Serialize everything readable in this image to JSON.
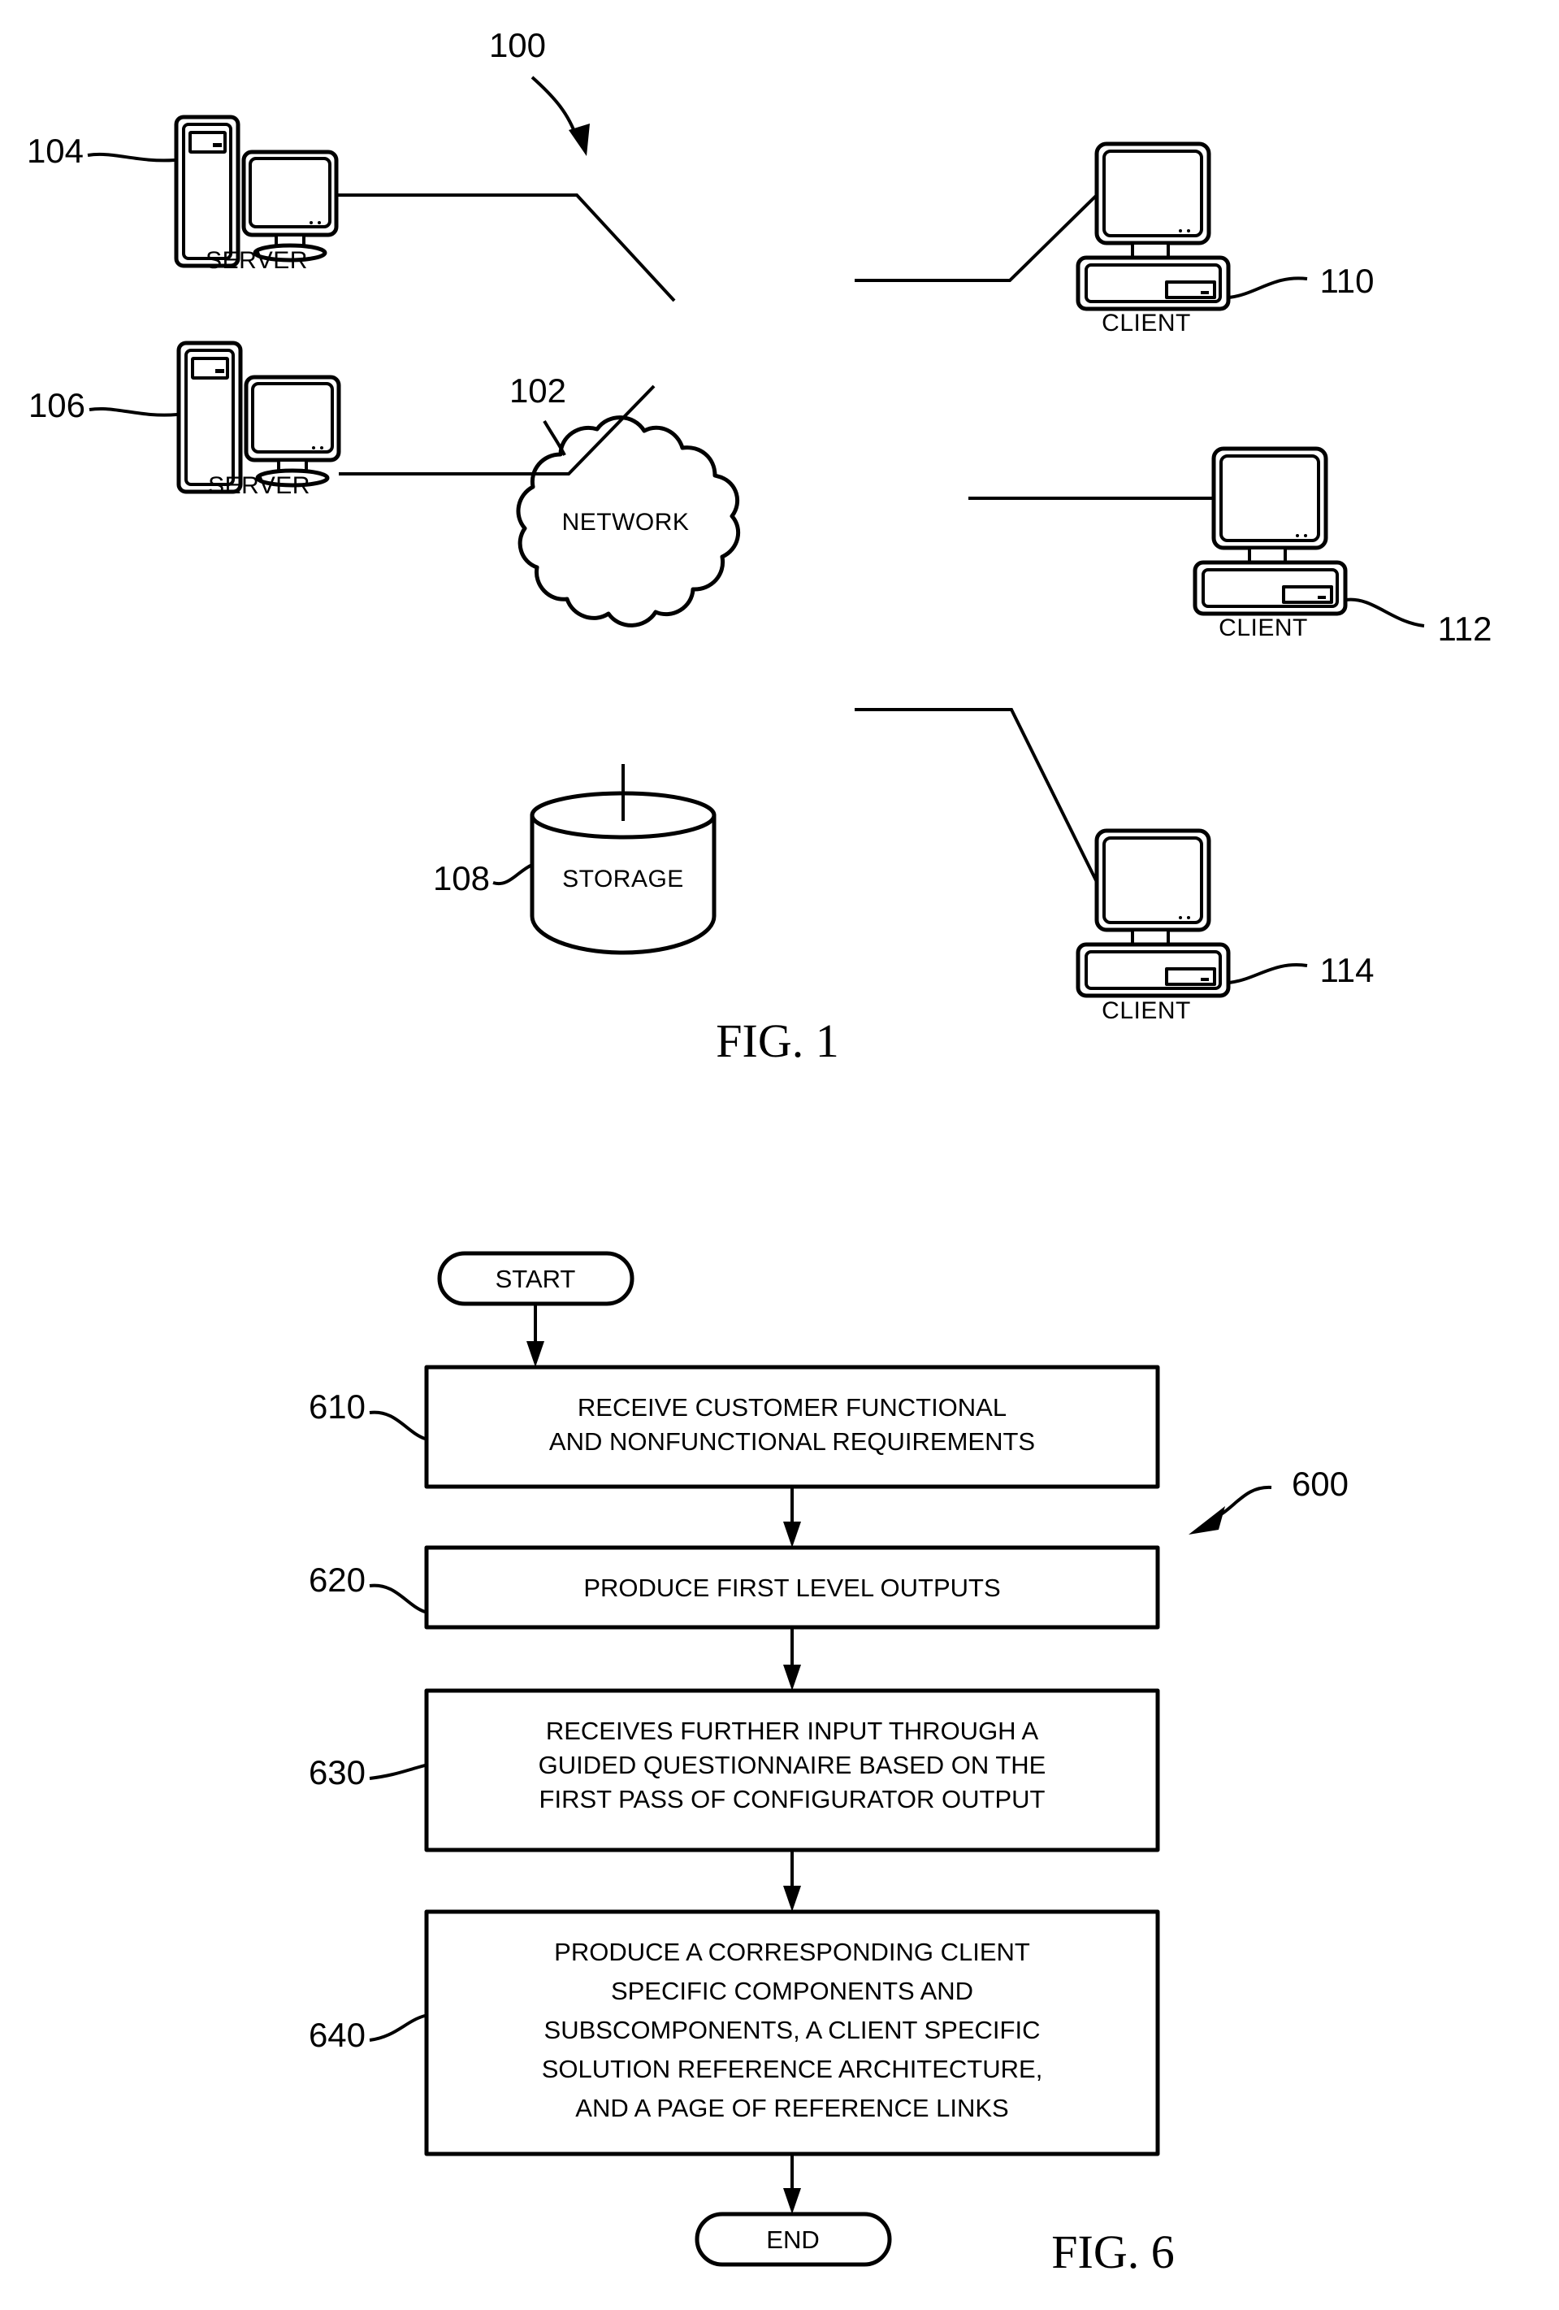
{
  "document": {
    "type": "patent-drawing-sheet",
    "figures": [
      "FIG. 1",
      "FIG. 6"
    ]
  },
  "figure1": {
    "caption": "FIG. 1",
    "system_ref": "100",
    "nodes": {
      "server_top": {
        "label": "SERVER",
        "ref": "104"
      },
      "server_bottom": {
        "label": "SERVER",
        "ref": "106"
      },
      "network": {
        "label": "NETWORK",
        "ref": "102"
      },
      "storage": {
        "label": "STORAGE",
        "ref": "108"
      },
      "client_top": {
        "label": "CLIENT",
        "ref": "110"
      },
      "client_mid": {
        "label": "CLIENT",
        "ref": "112"
      },
      "client_bottom": {
        "label": "CLIENT",
        "ref": "114"
      }
    }
  },
  "figure6": {
    "caption": "FIG. 6",
    "process_ref": "600",
    "start_label": "START",
    "end_label": "END",
    "steps": [
      {
        "ref": "610",
        "lines": [
          "RECEIVE CUSTOMER FUNCTIONAL",
          "AND NONFUNCTIONAL REQUIREMENTS"
        ]
      },
      {
        "ref": "620",
        "lines": [
          "PRODUCE FIRST LEVEL OUTPUTS"
        ]
      },
      {
        "ref": "630",
        "lines": [
          "RECEIVES FURTHER INPUT THROUGH A",
          "GUIDED QUESTIONNAIRE BASED ON THE",
          "FIRST PASS OF CONFIGURATOR OUTPUT"
        ]
      },
      {
        "ref": "640",
        "lines": [
          "PRODUCE A CORRESPONDING CLIENT",
          "SPECIFIC COMPONENTS AND",
          "SUBSCOMPONENTS, A CLIENT SPECIFIC",
          "SOLUTION REFERENCE ARCHITECTURE,",
          "AND A PAGE OF REFERENCE LINKS"
        ]
      }
    ]
  },
  "colors": {
    "ink": "#000000",
    "paper": "#ffffff"
  }
}
